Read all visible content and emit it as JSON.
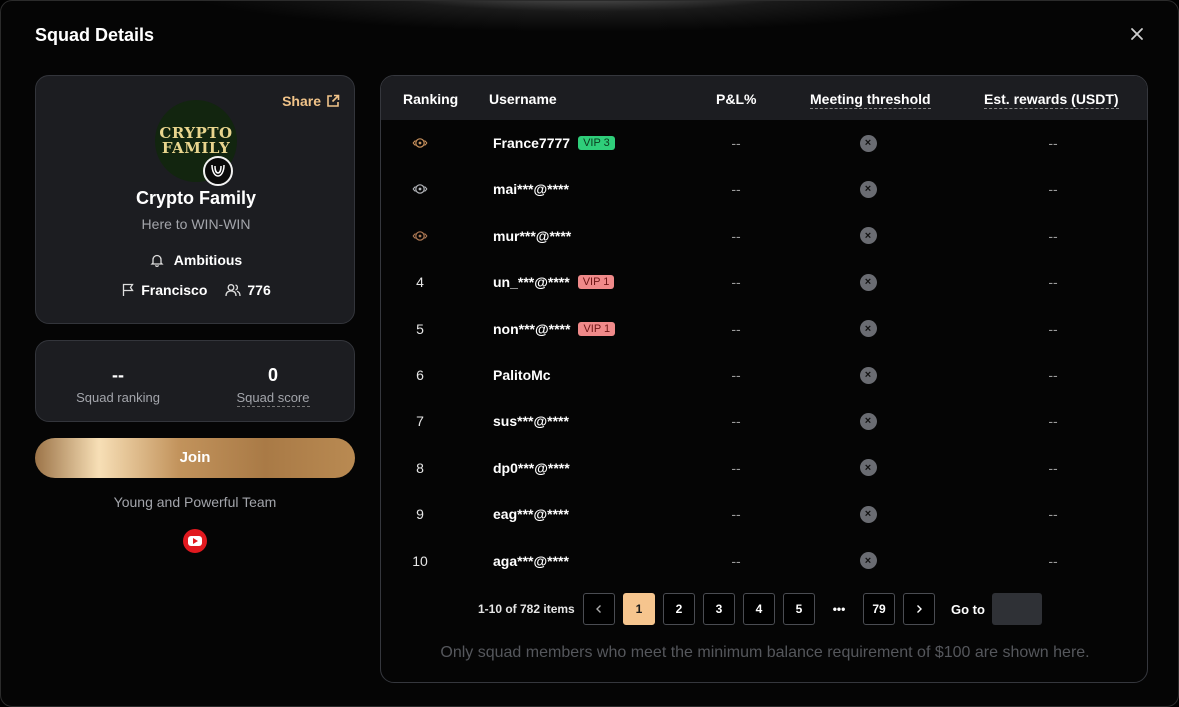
{
  "modal": {
    "title": "Squad Details",
    "close": "×"
  },
  "profile": {
    "share_label": "Share",
    "avatar_text_1": "CRYPTO",
    "avatar_text_2": "FAMILY",
    "name": "Crypto Family",
    "slogan": "Here to WIN-WIN",
    "level": "Ambitious",
    "leader": "Francisco",
    "members": "776"
  },
  "stats": {
    "ranking_value": "--",
    "ranking_label": "Squad ranking",
    "score_value": "0",
    "score_label": "Squad score"
  },
  "join_label": "Join",
  "tagline": "Young and Powerful Team",
  "social_icon": "youtube-icon",
  "table": {
    "headers": [
      "Ranking",
      "Username",
      "P&L%",
      "Meeting threshold",
      "Est. rewards (USDT)"
    ],
    "rows": [
      {
        "rank": "",
        "medal": "gold",
        "user": "France7777",
        "vip": "VIP 3",
        "vip_color": "green",
        "pnl": "--",
        "rewards": "--"
      },
      {
        "rank": "",
        "medal": "silver",
        "user": "mai***@****",
        "vip": "",
        "vip_color": "",
        "pnl": "--",
        "rewards": "--"
      },
      {
        "rank": "",
        "medal": "bronze",
        "user": "mur***@****",
        "vip": "",
        "vip_color": "",
        "pnl": "--",
        "rewards": "--"
      },
      {
        "rank": "4",
        "medal": "",
        "user": "un_***@****",
        "vip": "VIP 1",
        "vip_color": "red",
        "pnl": "--",
        "rewards": "--"
      },
      {
        "rank": "5",
        "medal": "",
        "user": "non***@****",
        "vip": "VIP 1",
        "vip_color": "red",
        "pnl": "--",
        "rewards": "--"
      },
      {
        "rank": "6",
        "medal": "",
        "user": "PalitoMc",
        "vip": "",
        "vip_color": "",
        "pnl": "--",
        "rewards": "--"
      },
      {
        "rank": "7",
        "medal": "",
        "user": "sus***@****",
        "vip": "",
        "vip_color": "",
        "pnl": "--",
        "rewards": "--"
      },
      {
        "rank": "8",
        "medal": "",
        "user": "dp0***@****",
        "vip": "",
        "vip_color": "",
        "pnl": "--",
        "rewards": "--"
      },
      {
        "rank": "9",
        "medal": "",
        "user": "eag***@****",
        "vip": "",
        "vip_color": "",
        "pnl": "--",
        "rewards": "--"
      },
      {
        "rank": "10",
        "medal": "",
        "user": "aga***@****",
        "vip": "",
        "vip_color": "",
        "pnl": "--",
        "rewards": "--"
      }
    ]
  },
  "pagination": {
    "info": "1-10 of 782 items",
    "pages": [
      "1",
      "2",
      "3",
      "4",
      "5",
      "•••",
      "79"
    ],
    "active": "1",
    "goto_label": "Go to",
    "goto_value": ""
  },
  "note": "Only squad members who meet the minimum balance requirement of $100 are shown here.",
  "colors": {
    "accent": "#f6c58e",
    "vip_green": "#2fce7a",
    "vip_red": "#f08a8a"
  }
}
